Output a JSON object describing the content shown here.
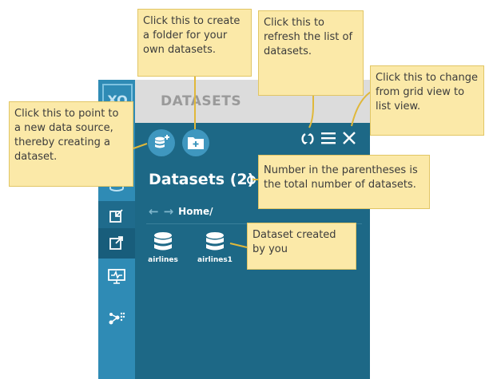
{
  "app": {
    "logo_text": "XO",
    "panel_header": "DATASETS",
    "title": "Datasets (2)",
    "breadcrumb": "Home/"
  },
  "nav_icons": [
    "database-icon",
    "import-icon",
    "export-icon",
    "monitor-icon",
    "graph-icon"
  ],
  "toolbar": {
    "add_datasource_icon": "add-datasource-icon",
    "add_folder_icon": "add-folder-icon",
    "refresh_icon": "refresh-icon",
    "list_view_icon": "list-view-icon",
    "close_icon": "close-icon"
  },
  "datasets": [
    {
      "name": "airlines"
    },
    {
      "name": "airlines1"
    }
  ],
  "callouts": {
    "create_folder": "Click this to create a folder for your own datasets.",
    "refresh": "Click this to refresh the list of datasets.",
    "view_toggle": "Click this to change from grid view to list view.",
    "new_datasource": "Click this to point to a new data source, thereby creating a dataset.",
    "count": "Number in the parentheses is the total number of datasets.",
    "dataset_created": "Dataset created by you"
  },
  "colors": {
    "panel": "#1d6886",
    "nav": "#2f8bb5",
    "callout": "#fbe9a8",
    "callout_border": "#e1c665"
  }
}
